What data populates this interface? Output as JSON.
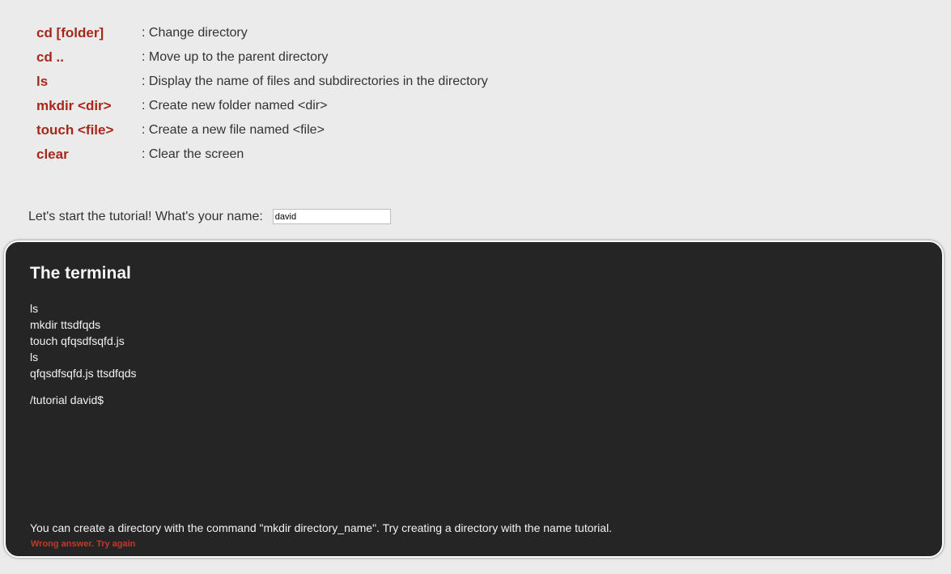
{
  "commands": [
    {
      "name": "cd [folder]",
      "desc": ": Change directory"
    },
    {
      "name": "cd ..",
      "desc": ": Move up to the parent directory"
    },
    {
      "name": "ls",
      "desc": ": Display the name of files and subdirectories in the directory"
    },
    {
      "name": "mkdir <dir>",
      "desc": ": Create new folder named <dir>"
    },
    {
      "name": "touch <file>",
      "desc": ": Create a new file named <file>"
    },
    {
      "name": "clear",
      "desc": ": Clear the screen"
    }
  ],
  "name_prompt": {
    "label": "Let's start the tutorial! What's your name:",
    "value": "david"
  },
  "terminal": {
    "title": "The terminal",
    "history": [
      "ls",
      "mkdir ttsdfqds",
      "touch qfqsdfsqfd.js",
      "ls",
      "qfqsdfsqfd.js ttsdfqds"
    ],
    "prompt": "/tutorial david$",
    "hint": "You can create a directory with the command \"mkdir directory_name\". Try creating a directory with the name tutorial.",
    "error": "Wrong answer. Try again"
  },
  "colors": {
    "background": "#ebebeb",
    "command_accent": "#a8271b",
    "terminal_bg": "#252525",
    "error": "#c0392b"
  }
}
